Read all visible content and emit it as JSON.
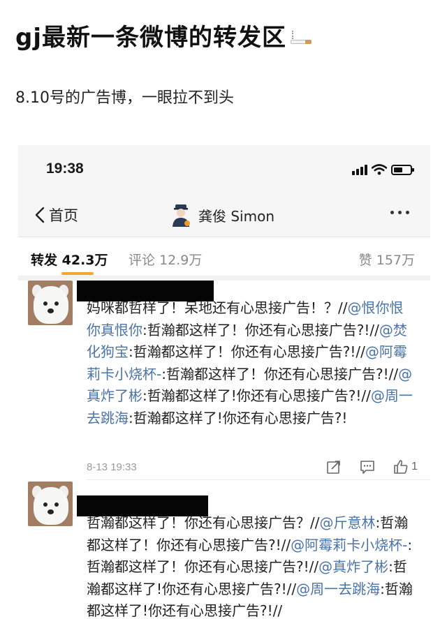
{
  "post": {
    "title": "gj最新一条微博的转发区",
    "subtitle": "8.10号的广告博，一眼拉不到头"
  },
  "status_bar": {
    "time": "19:38",
    "icons": [
      "signal-icon",
      "wifi-icon",
      "battery-icon"
    ]
  },
  "nav": {
    "back_label": "首页",
    "user_name": "龚俊 Simon",
    "icons": [
      "back-chevron-icon",
      "avatar-icon",
      "more-icon"
    ]
  },
  "tabs": {
    "repost_label": "转发",
    "repost_count": "42.3万",
    "comment_label": "评论",
    "comment_count": "12.9万",
    "like_label": "赞",
    "like_count": "157万"
  },
  "reposts": [
    {
      "segments": [
        {
          "t": "妈咪都哲样了！呆地还有心思接广告！？//",
          "m": false
        },
        {
          "t": "@恨你恨你真恨你",
          "m": true
        },
        {
          "t": ":哲瀚都这样了！你还有心思接广告?!//",
          "m": false
        },
        {
          "t": "@焚化狗宝",
          "m": true
        },
        {
          "t": ":哲瀚都这样了！你还有心思接广告?!//",
          "m": false
        },
        {
          "t": "@阿霉莉卡小烧杯-",
          "m": true
        },
        {
          "t": ":哲瀚都这样了！你还有心思接广告?!//",
          "m": false
        },
        {
          "t": "@真炸了彬",
          "m": true
        },
        {
          "t": ":哲瀚都这样了!你还有心思接广告?!//",
          "m": false
        },
        {
          "t": "@周一去跳海",
          "m": true
        },
        {
          "t": ":哲瀚都这样了!你还有心思接广告?!",
          "m": false
        }
      ],
      "time": "8-13 19:33",
      "like_count": "1"
    },
    {
      "segments": [
        {
          "t": "哲瀚都这样了！你还有心思接广告？//",
          "m": false
        },
        {
          "t": "@斤意林",
          "m": true
        },
        {
          "t": ":哲瀚都这样了！你还有心思接广告?!//",
          "m": false
        },
        {
          "t": "@阿霉莉卡小烧杯-",
          "m": true
        },
        {
          "t": ":哲瀚都这样了！你还有心思接广告?!//",
          "m": false
        },
        {
          "t": "@真炸了彬",
          "m": true
        },
        {
          "t": ":哲瀚都这样了!你还有心思接广告?!//",
          "m": false
        },
        {
          "t": "@周一去跳海",
          "m": true
        },
        {
          "t": ":哲瀚都这样了!你还有心思接广告?!//",
          "m": false
        }
      ],
      "time": "",
      "like_count": ""
    }
  ]
}
